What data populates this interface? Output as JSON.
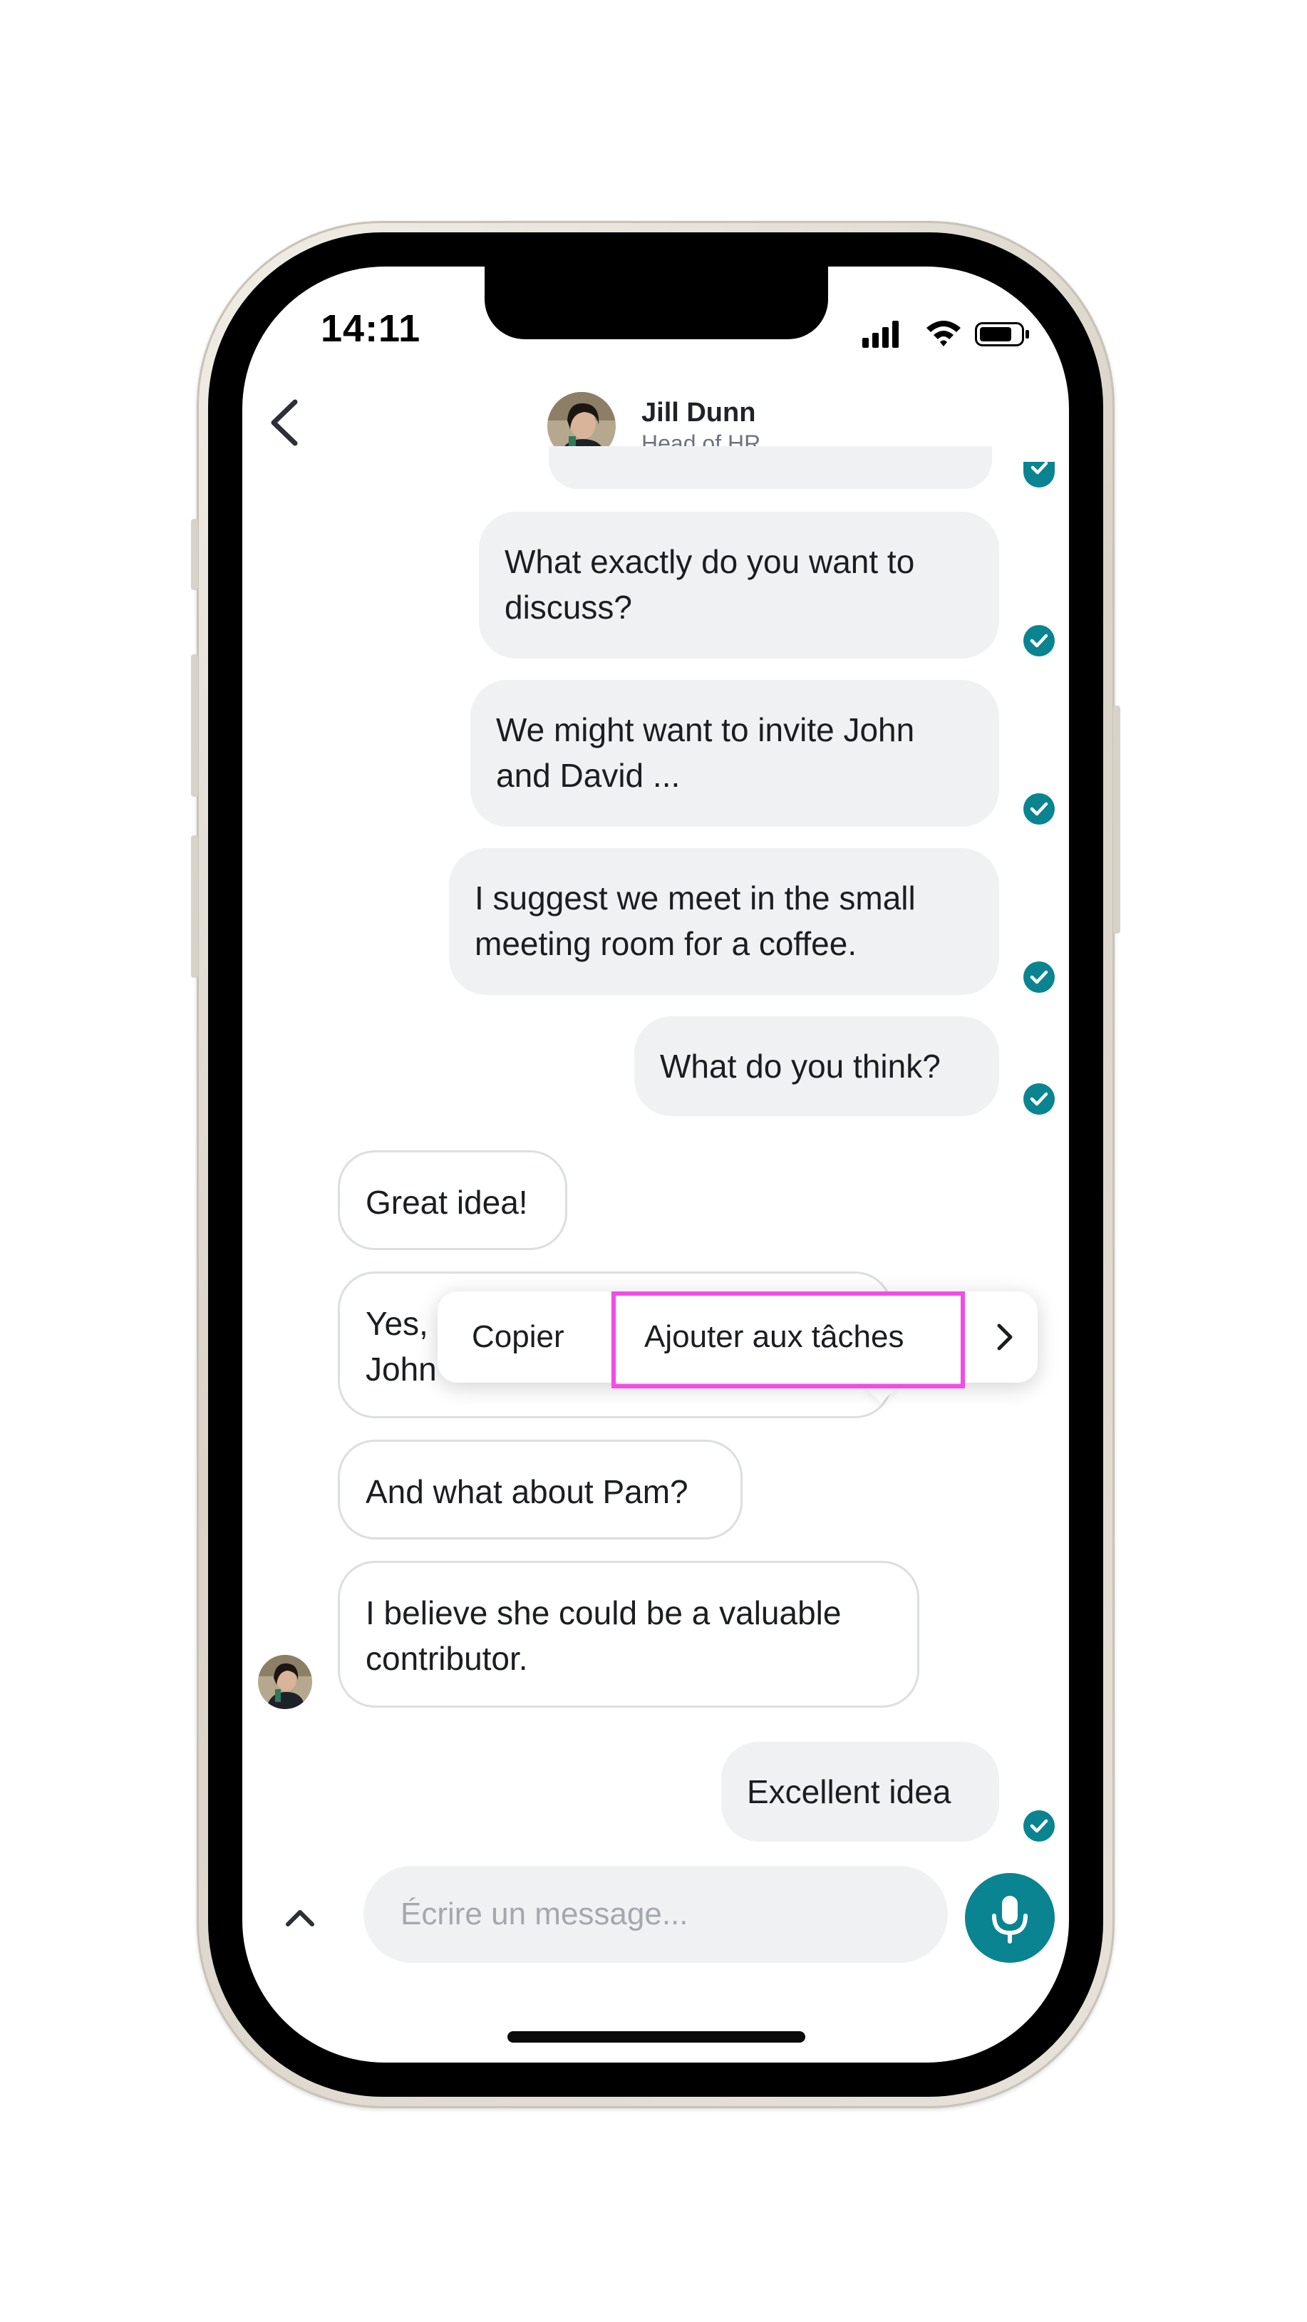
{
  "status_bar": {
    "time": "14:11"
  },
  "header": {
    "name": "Jill Dunn",
    "role": "Head of HR"
  },
  "messages": {
    "m1": {
      "line1": "What exactly do you want to",
      "line2": "discuss?"
    },
    "m2": {
      "line1": "We might want to invite John",
      "line2": "and David ..."
    },
    "m3": {
      "line1": "I suggest we meet in the small",
      "line2": "meeting room for a coffee."
    },
    "m4": {
      "line1": "What do you think?"
    },
    "r1": {
      "line1": "Great idea!"
    },
    "r2": {
      "line1": "Yes,",
      "line2": "John"
    },
    "r3": {
      "line1": "And what about Pam?"
    },
    "r4": {
      "line1": "I believe she could be a valuable",
      "line2": "contributor."
    },
    "m5": {
      "line1": "Excellent idea"
    }
  },
  "context_menu": {
    "copy": "Copier",
    "add_to_tasks": "Ajouter aux tâches"
  },
  "composer": {
    "placeholder": "Écrire un message..."
  },
  "colors": {
    "accent": "#0a8491",
    "highlight": "#f24be7",
    "outgoing_bubble": "#f0f1f3"
  },
  "icons": [
    "chevron-left-icon",
    "signal-icon",
    "wifi-icon",
    "battery-icon",
    "check-icon",
    "chevron-right-icon",
    "chevron-up-icon",
    "microphone-icon"
  ]
}
